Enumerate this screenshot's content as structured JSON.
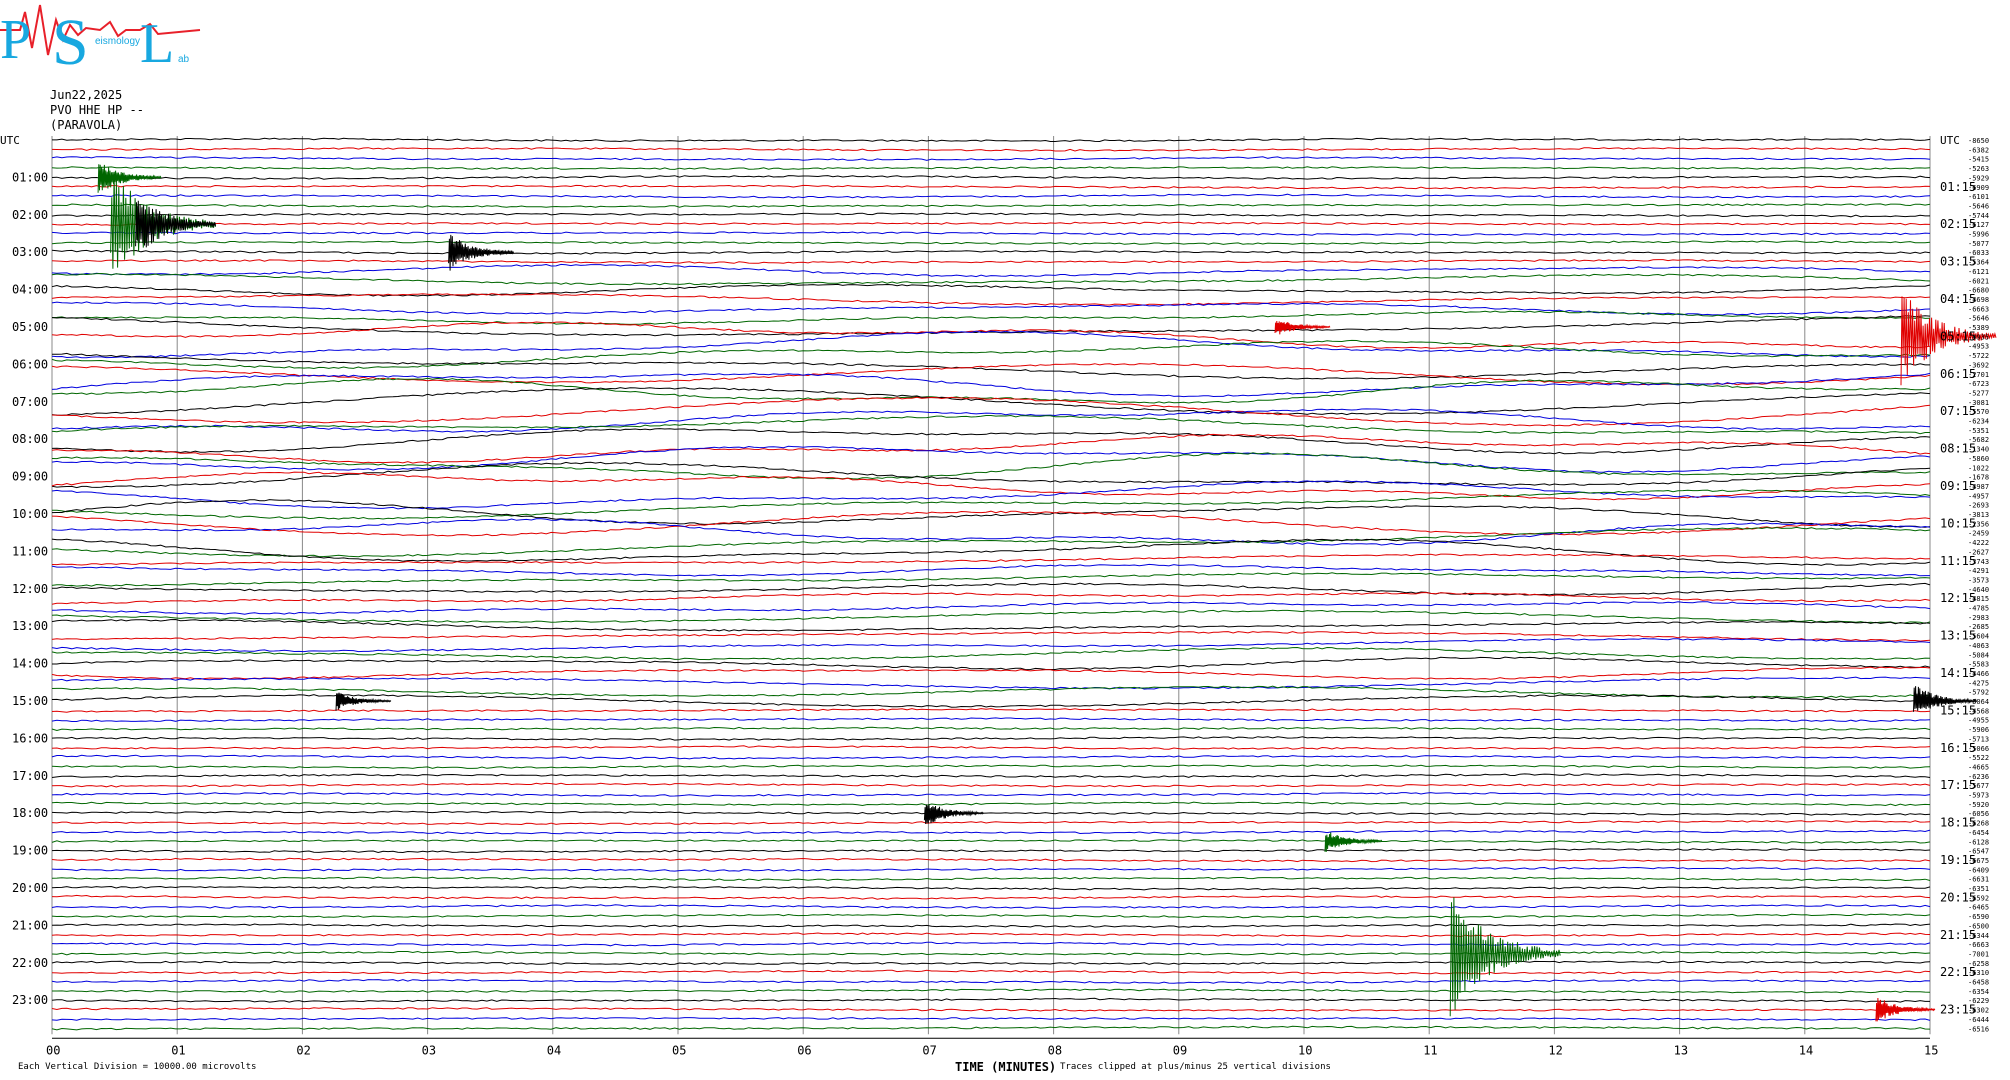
{
  "logo": {
    "text_main": "PSL",
    "text_sub_1": "eismology",
    "text_sub_2": "ab"
  },
  "header": {
    "date": "Jun22,2025",
    "station": "PVO HHE HP --",
    "location": "(PARAVOLA)"
  },
  "axis": {
    "utc_label": "UTC",
    "left_times": [
      "01:00",
      "02:00",
      "03:00",
      "04:00",
      "05:00",
      "06:00",
      "07:00",
      "08:00",
      "09:00",
      "10:00",
      "11:00",
      "12:00",
      "13:00",
      "14:00",
      "15:00",
      "16:00",
      "17:00",
      "18:00",
      "19:00",
      "20:00",
      "21:00",
      "22:00",
      "23:00"
    ],
    "right_times": [
      "01:15",
      "02:15",
      "03:15",
      "04:15",
      "05:15",
      "06:15",
      "07:15",
      "08:15",
      "09:15",
      "10:15",
      "11:15",
      "12:15",
      "13:15",
      "14:15",
      "15:15",
      "16:15",
      "17:15",
      "18:15",
      "19:15",
      "20:15",
      "21:15",
      "22:15",
      "23:15"
    ],
    "x_ticks": [
      "00",
      "01",
      "02",
      "03",
      "04",
      "05",
      "06",
      "07",
      "08",
      "09",
      "10",
      "11",
      "12",
      "13",
      "14",
      "15"
    ],
    "x_title": "TIME (MINUTES)"
  },
  "footer": {
    "left_note": "Each Vertical Division = 10000.00 microvolts",
    "right_note": "Traces clipped at plus/minus 25 vertical divisions"
  },
  "colors": {
    "trace_cycle": [
      "#000000",
      "#e00000",
      "#0000dd",
      "#006600"
    ],
    "grid": "#888888",
    "logo_cyan": "#18a8e0",
    "logo_red": "#e8202a"
  },
  "chart_data": {
    "type": "line",
    "title": "",
    "xlabel": "TIME (MINUTES)",
    "x_range": [
      0,
      15
    ],
    "rows": 96,
    "row_minutes": 15,
    "grid": "vertical lines each minute",
    "trace_offsets": [
      -8650,
      -6382,
      -5415,
      -5263,
      -5929,
      -6909,
      -6101,
      -5646,
      -5744,
      -6127,
      -5996,
      -5077,
      -6033,
      -5364,
      -6121,
      -6021,
      -6680,
      -4698,
      -6663,
      -5646,
      -5389,
      -4935,
      -4953,
      -5722,
      -3692,
      -2701,
      -6723,
      -5277,
      -3081,
      -5570,
      -6234,
      -5351,
      -5682,
      -1340,
      -5860,
      -1022,
      -1678,
      -4987,
      -4957,
      -2693,
      -3813,
      -2356,
      -2459,
      -4222,
      -2627,
      -3743,
      -4291,
      -3573,
      -4640,
      -4815,
      -4785,
      -2983,
      -2685,
      -5604,
      -4063,
      -5084,
      -5583,
      -4466,
      -4275,
      -5792,
      -5064,
      -4568,
      -4955,
      -5906,
      -5713,
      -5066,
      -5522,
      -4665,
      -6236,
      -5677,
      -5973,
      -5920,
      -6056,
      -6268,
      -6454,
      -6128,
      -6547,
      -6675,
      -6409,
      -6631,
      -6351,
      -6592,
      -6465,
      -6590,
      -6500,
      -6344,
      -6663,
      -7001,
      -6258,
      -6310,
      -6458,
      -6354,
      -6229,
      -6302,
      -6444,
      -6516
    ],
    "events": [
      {
        "row": 9,
        "minute": 0.5,
        "amp": 60,
        "color": "#006600"
      },
      {
        "row": 9,
        "minute": 0.7,
        "amp": 35,
        "color": "#000000"
      },
      {
        "row": 4,
        "minute": 0.4,
        "amp": 18,
        "color": "#006600"
      },
      {
        "row": 12,
        "minute": 3.2,
        "amp": 20,
        "color": "#000000"
      },
      {
        "row": 21,
        "minute": 14.8,
        "amp": 50,
        "color": "#e00000"
      },
      {
        "row": 60,
        "minute": 2.3,
        "amp": 10,
        "color": "#000000"
      },
      {
        "row": 60,
        "minute": 14.9,
        "amp": 18,
        "color": "#000000"
      },
      {
        "row": 72,
        "minute": 7.0,
        "amp": 14,
        "color": "#000000"
      },
      {
        "row": 75,
        "minute": 10.2,
        "amp": 12,
        "color": "#006600"
      },
      {
        "row": 87,
        "minute": 11.2,
        "amp": 65,
        "color": "#006600"
      },
      {
        "row": 93,
        "minute": 14.6,
        "amp": 14,
        "color": "#e00000"
      },
      {
        "row": 20,
        "minute": 9.8,
        "amp": 10,
        "color": "#e00000"
      }
    ]
  }
}
